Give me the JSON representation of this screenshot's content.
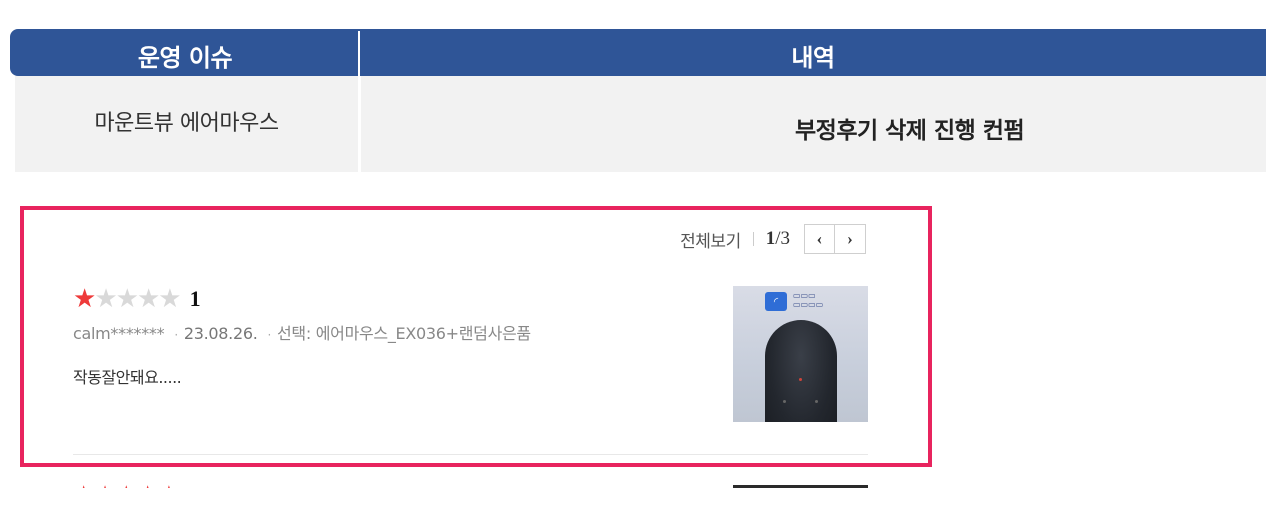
{
  "table": {
    "headers": {
      "issue": "운영 이슈",
      "detail": "내역"
    },
    "row": {
      "issue": "마운트뷰 에어마우스",
      "detail": "부정후기 삭제 진행 컨펌"
    }
  },
  "review_panel": {
    "view_all": "전체보기",
    "page_current": "1",
    "page_total": "/3",
    "prev_glyph": "‹",
    "next_glyph": "›",
    "review": {
      "rating": 1,
      "rating_label": "1",
      "max_stars": 5,
      "user": "calm*******",
      "date": "23.08.26.",
      "option": "선택: 에어마우스_EX036+랜덤사은품",
      "text": "작동잘안돼요.....",
      "thumbnail": {
        "subject": "black air mouse on blue-white box",
        "logo": "wifi-icon"
      }
    }
  },
  "colors": {
    "header_bg": "#2f5597",
    "row_bg": "#f2f2f2",
    "highlight_border": "#e8245e",
    "star_on": "#ee3a3a",
    "star_off": "#d9d9d9"
  }
}
